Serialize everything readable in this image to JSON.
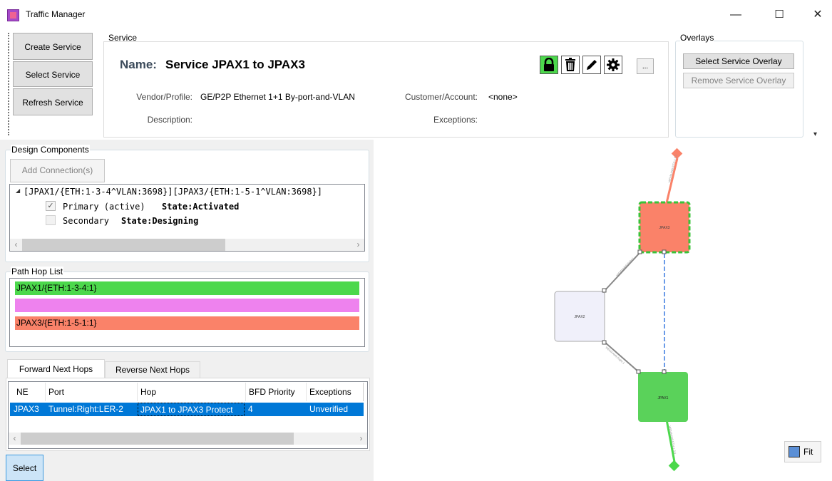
{
  "window": {
    "title": "Traffic Manager",
    "minimize": "—",
    "maximize": "☐",
    "close": "✕"
  },
  "toolbar": {
    "create_service": "Create Service",
    "select_service": "Select Service",
    "refresh_service": "Refresh Service"
  },
  "service": {
    "group_label": "Service",
    "name_label": "Name:",
    "name_value": "Service JPAX1 to JPAX3",
    "vendor_label": "Vendor/Profile:",
    "vendor_value": "GE/P2P Ethernet 1+1 By-port-and-VLAN",
    "customer_label": "Customer/Account:",
    "customer_value": "<none>",
    "description_label": "Description:",
    "exceptions_label": "Exceptions:",
    "more_label": "..."
  },
  "overlays": {
    "group_label": "Overlays",
    "select": "Select Service Overlay",
    "remove": "Remove Service Overlay"
  },
  "design": {
    "group_label": "Design Components",
    "add_button": "Add Connection(s)",
    "tree_root": "[JPAX1/{ETH:1-3-4^VLAN:3698}][JPAX3/{ETH:1-5-1^VLAN:3698}]",
    "primary_label": "Primary (active)",
    "primary_state": "State:Activated",
    "secondary_label": "Secondary",
    "secondary_state": "State:Designing"
  },
  "path_hops": {
    "group_label": "Path Hop List",
    "items": [
      {
        "label": "JPAX1/{ETH:1-3-4:1}",
        "color": "#4cd84c"
      },
      {
        "label": "",
        "color": "#ee82ee"
      },
      {
        "label": "JPAX3/{ETH:1-5-1:1}",
        "color": "#fa8269"
      }
    ]
  },
  "next_hops": {
    "tabs": [
      "Forward Next Hops",
      "Reverse Next Hops"
    ],
    "columns": [
      "NE",
      "Port",
      "Hop",
      "BFD Priority",
      "Exceptions"
    ],
    "rows": [
      {
        "ne": "JPAX3",
        "port": "Tunnel:Right:LER-2",
        "hop": "JPAX1 to JPAX3 Protect",
        "bfd": "4",
        "exceptions": "Unverified"
      }
    ]
  },
  "select_button": "Select",
  "canvas": {
    "nodes": [
      {
        "label": "JPAX3",
        "color": "#fa8269"
      },
      {
        "label": "JPAX2",
        "color": "#f0f0fa"
      },
      {
        "label": "JPAX1",
        "color": "#5ad25a"
      }
    ],
    "fit_label": "Fit"
  },
  "colors": {
    "selection": "#0078d7",
    "accent_green": "#4cd84c",
    "accent_salmon": "#fa8269"
  }
}
